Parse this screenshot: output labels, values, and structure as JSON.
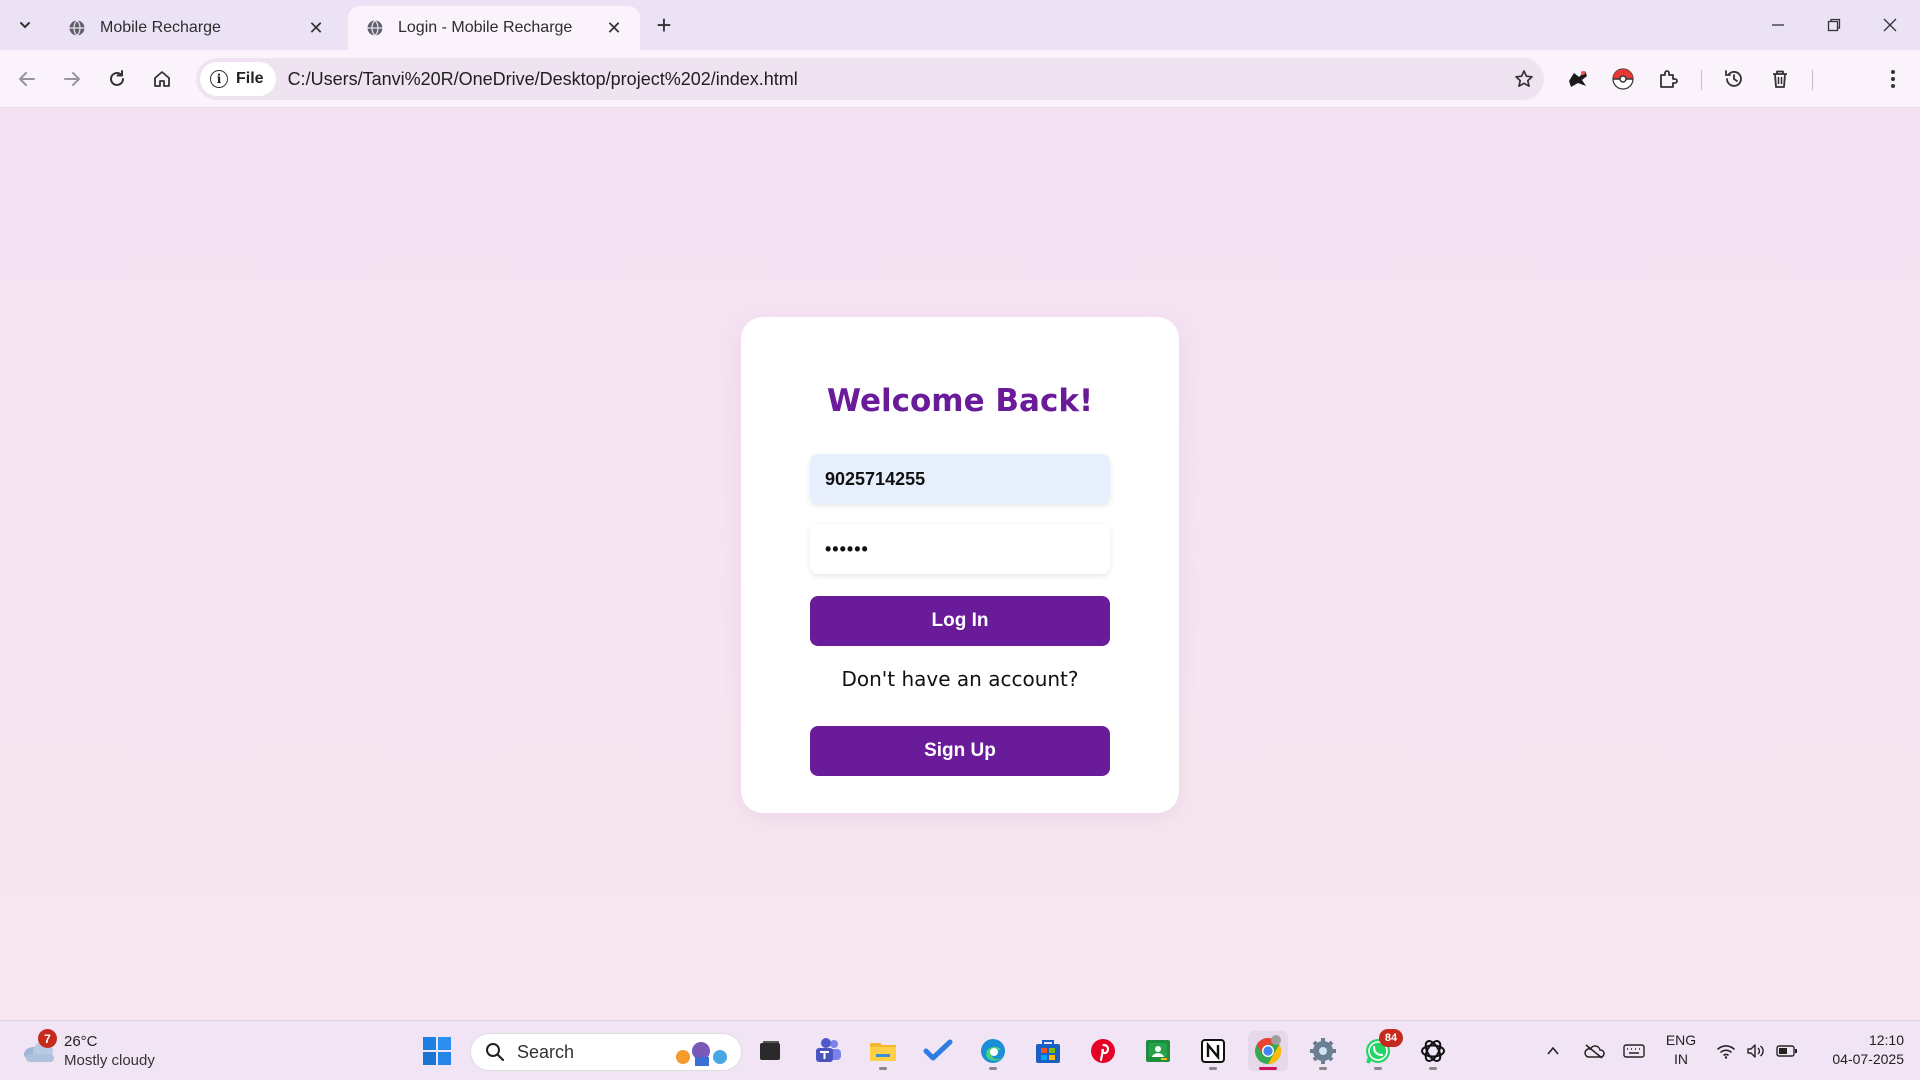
{
  "browser": {
    "tabs": [
      {
        "title": "Mobile Recharge",
        "active": false
      },
      {
        "title": "Login - Mobile Recharge",
        "active": true
      }
    ],
    "address_chip": "File",
    "url": "C:/Users/Tanvi%20R/OneDrive/Desktop/project%202/index.html"
  },
  "login": {
    "heading": "Welcome Back!",
    "phone_value": "9025714255",
    "password_value": "••••••",
    "login_button": "Log In",
    "signup_prompt": "Don't have an account?",
    "signup_button": "Sign Up"
  },
  "taskbar": {
    "weather_badge": "7",
    "temperature": "26°C",
    "condition": "Mostly cloudy",
    "search_label": "Search",
    "whatsapp_badge": "84",
    "language": "ENG",
    "region": "IN",
    "time": "12:10",
    "date": "04-07-2025"
  },
  "colors": {
    "accent": "#6a1b9a",
    "page_background": "#f6e4f2",
    "card": "#ffffff",
    "phone_field": "#e8effc"
  },
  "icons": [
    "tab-search-icon",
    "globe-icon",
    "close-icon",
    "new-tab-icon",
    "minimize-icon",
    "restore-icon",
    "window-close-icon",
    "back-arrow-icon",
    "forward-arrow-icon",
    "reload-icon",
    "home-icon",
    "info-icon",
    "star-icon",
    "extension-icon",
    "history-icon",
    "trash-icon",
    "more-vert-icon",
    "windows-start-icon",
    "search-icon",
    "chevron-up-icon",
    "wifi-icon",
    "volume-icon",
    "battery-icon"
  ]
}
